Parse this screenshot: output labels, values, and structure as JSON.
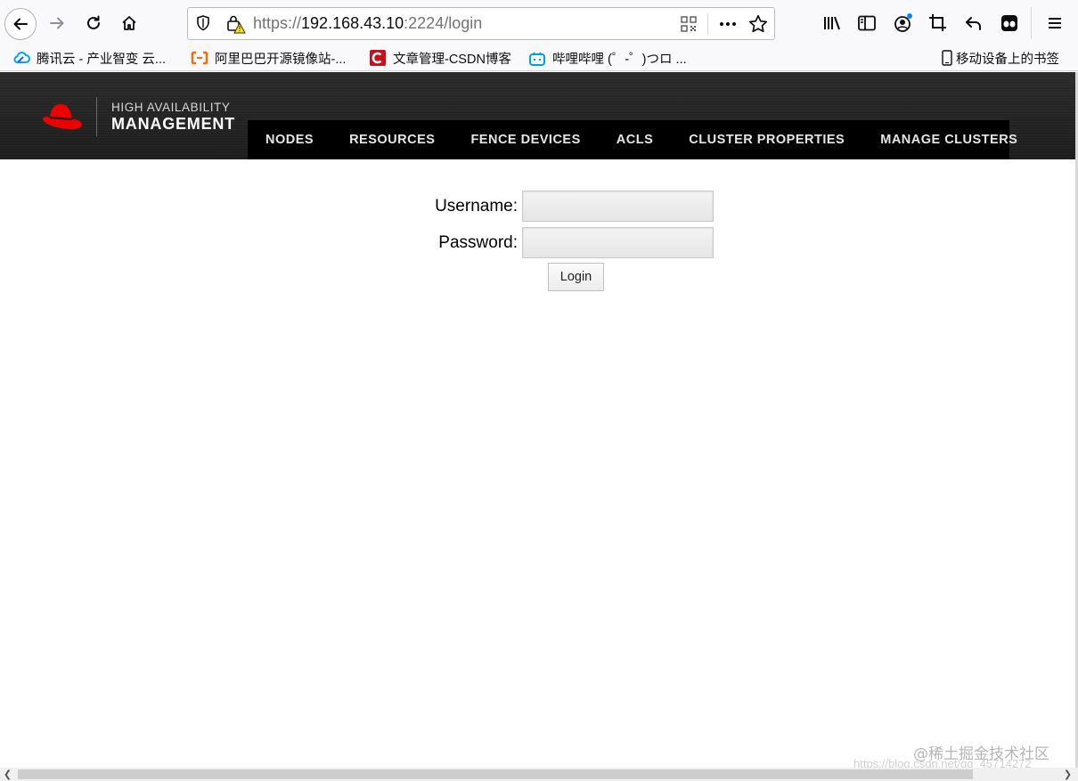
{
  "browser": {
    "url": {
      "scheme": "https://",
      "host": "192.168.43.10",
      "rest": ":2224/login"
    },
    "bookmarks": [
      {
        "label": "腾讯云 - 产业智变 云...",
        "icon": "tencent-cloud-icon"
      },
      {
        "label": "阿里巴巴开源镜像站-...",
        "icon": "aliyun-icon"
      },
      {
        "label": "文章管理-CSDN博客",
        "icon": "csdn-icon"
      },
      {
        "label": "哔哩哔哩 (゜-゜)つロ ...",
        "icon": "bilibili-icon"
      }
    ],
    "mobile_bookmarks": "移动设备上的书签"
  },
  "app": {
    "brand": {
      "line1": "HIGH AVAILABILITY",
      "line2": "MANAGEMENT"
    },
    "nav": [
      "NODES",
      "RESOURCES",
      "FENCE DEVICES",
      "ACLS",
      "CLUSTER PROPERTIES",
      "MANAGE CLUSTERS"
    ]
  },
  "login": {
    "username_label": "Username:",
    "password_label": "Password:",
    "username_value": "",
    "password_value": "",
    "submit_label": "Login"
  },
  "watermark": {
    "text": "@稀土掘金技术社区",
    "url": "https://blog.csdn.net/qq_45714272"
  },
  "colors": {
    "brand_red": "#ee0000",
    "nav_background": "#000000",
    "header_background": "#252525"
  }
}
